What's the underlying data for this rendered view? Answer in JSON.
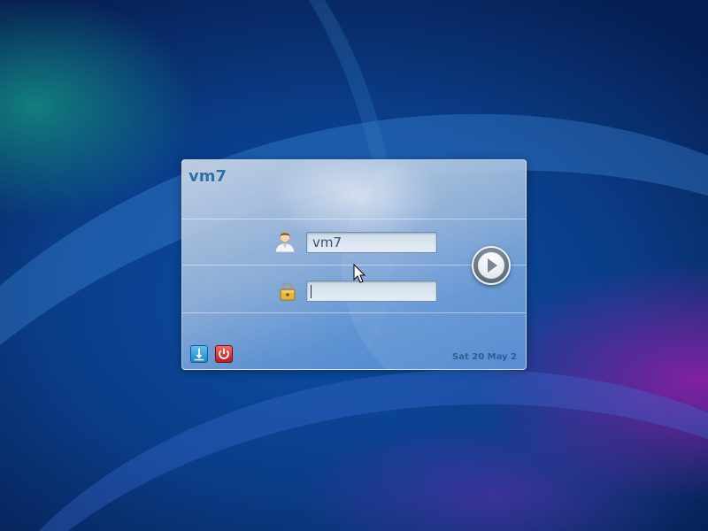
{
  "login": {
    "hostname": "vm7",
    "username_value": "vm7",
    "password_value": "",
    "datetime": "Sat 20 May 2"
  },
  "icons": {
    "user": "user-icon",
    "lock": "lock-icon",
    "login": "play-icon",
    "menu": "down-arrow-icon",
    "shutdown": "power-icon",
    "cursor": "mouse-pointer-icon"
  },
  "colors": {
    "hostname": "#2e6fa7",
    "field_text": "#2c5577",
    "menu_button": "#1b86cf",
    "shutdown_button": "#b81d1d"
  }
}
